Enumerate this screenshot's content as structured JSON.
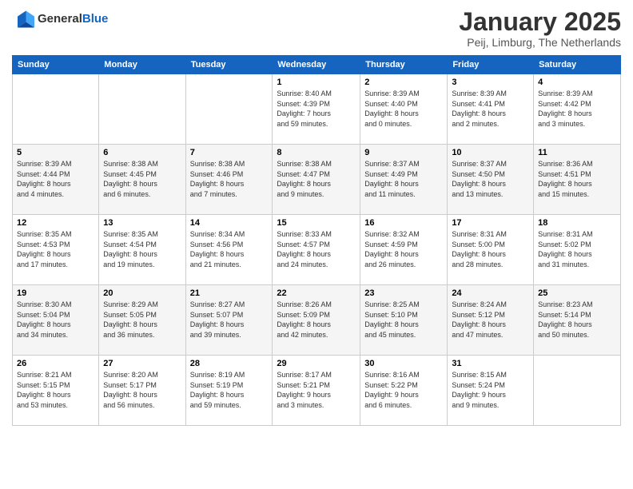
{
  "logo": {
    "general": "General",
    "blue": "Blue"
  },
  "header": {
    "month": "January 2025",
    "location": "Peij, Limburg, The Netherlands"
  },
  "weekdays": [
    "Sunday",
    "Monday",
    "Tuesday",
    "Wednesday",
    "Thursday",
    "Friday",
    "Saturday"
  ],
  "weeks": [
    [
      {
        "day": "",
        "info": ""
      },
      {
        "day": "",
        "info": ""
      },
      {
        "day": "",
        "info": ""
      },
      {
        "day": "1",
        "info": "Sunrise: 8:40 AM\nSunset: 4:39 PM\nDaylight: 7 hours\nand 59 minutes."
      },
      {
        "day": "2",
        "info": "Sunrise: 8:39 AM\nSunset: 4:40 PM\nDaylight: 8 hours\nand 0 minutes."
      },
      {
        "day": "3",
        "info": "Sunrise: 8:39 AM\nSunset: 4:41 PM\nDaylight: 8 hours\nand 2 minutes."
      },
      {
        "day": "4",
        "info": "Sunrise: 8:39 AM\nSunset: 4:42 PM\nDaylight: 8 hours\nand 3 minutes."
      }
    ],
    [
      {
        "day": "5",
        "info": "Sunrise: 8:39 AM\nSunset: 4:44 PM\nDaylight: 8 hours\nand 4 minutes."
      },
      {
        "day": "6",
        "info": "Sunrise: 8:38 AM\nSunset: 4:45 PM\nDaylight: 8 hours\nand 6 minutes."
      },
      {
        "day": "7",
        "info": "Sunrise: 8:38 AM\nSunset: 4:46 PM\nDaylight: 8 hours\nand 7 minutes."
      },
      {
        "day": "8",
        "info": "Sunrise: 8:38 AM\nSunset: 4:47 PM\nDaylight: 8 hours\nand 9 minutes."
      },
      {
        "day": "9",
        "info": "Sunrise: 8:37 AM\nSunset: 4:49 PM\nDaylight: 8 hours\nand 11 minutes."
      },
      {
        "day": "10",
        "info": "Sunrise: 8:37 AM\nSunset: 4:50 PM\nDaylight: 8 hours\nand 13 minutes."
      },
      {
        "day": "11",
        "info": "Sunrise: 8:36 AM\nSunset: 4:51 PM\nDaylight: 8 hours\nand 15 minutes."
      }
    ],
    [
      {
        "day": "12",
        "info": "Sunrise: 8:35 AM\nSunset: 4:53 PM\nDaylight: 8 hours\nand 17 minutes."
      },
      {
        "day": "13",
        "info": "Sunrise: 8:35 AM\nSunset: 4:54 PM\nDaylight: 8 hours\nand 19 minutes."
      },
      {
        "day": "14",
        "info": "Sunrise: 8:34 AM\nSunset: 4:56 PM\nDaylight: 8 hours\nand 21 minutes."
      },
      {
        "day": "15",
        "info": "Sunrise: 8:33 AM\nSunset: 4:57 PM\nDaylight: 8 hours\nand 24 minutes."
      },
      {
        "day": "16",
        "info": "Sunrise: 8:32 AM\nSunset: 4:59 PM\nDaylight: 8 hours\nand 26 minutes."
      },
      {
        "day": "17",
        "info": "Sunrise: 8:31 AM\nSunset: 5:00 PM\nDaylight: 8 hours\nand 28 minutes."
      },
      {
        "day": "18",
        "info": "Sunrise: 8:31 AM\nSunset: 5:02 PM\nDaylight: 8 hours\nand 31 minutes."
      }
    ],
    [
      {
        "day": "19",
        "info": "Sunrise: 8:30 AM\nSunset: 5:04 PM\nDaylight: 8 hours\nand 34 minutes."
      },
      {
        "day": "20",
        "info": "Sunrise: 8:29 AM\nSunset: 5:05 PM\nDaylight: 8 hours\nand 36 minutes."
      },
      {
        "day": "21",
        "info": "Sunrise: 8:27 AM\nSunset: 5:07 PM\nDaylight: 8 hours\nand 39 minutes."
      },
      {
        "day": "22",
        "info": "Sunrise: 8:26 AM\nSunset: 5:09 PM\nDaylight: 8 hours\nand 42 minutes."
      },
      {
        "day": "23",
        "info": "Sunrise: 8:25 AM\nSunset: 5:10 PM\nDaylight: 8 hours\nand 45 minutes."
      },
      {
        "day": "24",
        "info": "Sunrise: 8:24 AM\nSunset: 5:12 PM\nDaylight: 8 hours\nand 47 minutes."
      },
      {
        "day": "25",
        "info": "Sunrise: 8:23 AM\nSunset: 5:14 PM\nDaylight: 8 hours\nand 50 minutes."
      }
    ],
    [
      {
        "day": "26",
        "info": "Sunrise: 8:21 AM\nSunset: 5:15 PM\nDaylight: 8 hours\nand 53 minutes."
      },
      {
        "day": "27",
        "info": "Sunrise: 8:20 AM\nSunset: 5:17 PM\nDaylight: 8 hours\nand 56 minutes."
      },
      {
        "day": "28",
        "info": "Sunrise: 8:19 AM\nSunset: 5:19 PM\nDaylight: 8 hours\nand 59 minutes."
      },
      {
        "day": "29",
        "info": "Sunrise: 8:17 AM\nSunset: 5:21 PM\nDaylight: 9 hours\nand 3 minutes."
      },
      {
        "day": "30",
        "info": "Sunrise: 8:16 AM\nSunset: 5:22 PM\nDaylight: 9 hours\nand 6 minutes."
      },
      {
        "day": "31",
        "info": "Sunrise: 8:15 AM\nSunset: 5:24 PM\nDaylight: 9 hours\nand 9 minutes."
      },
      {
        "day": "",
        "info": ""
      }
    ]
  ]
}
